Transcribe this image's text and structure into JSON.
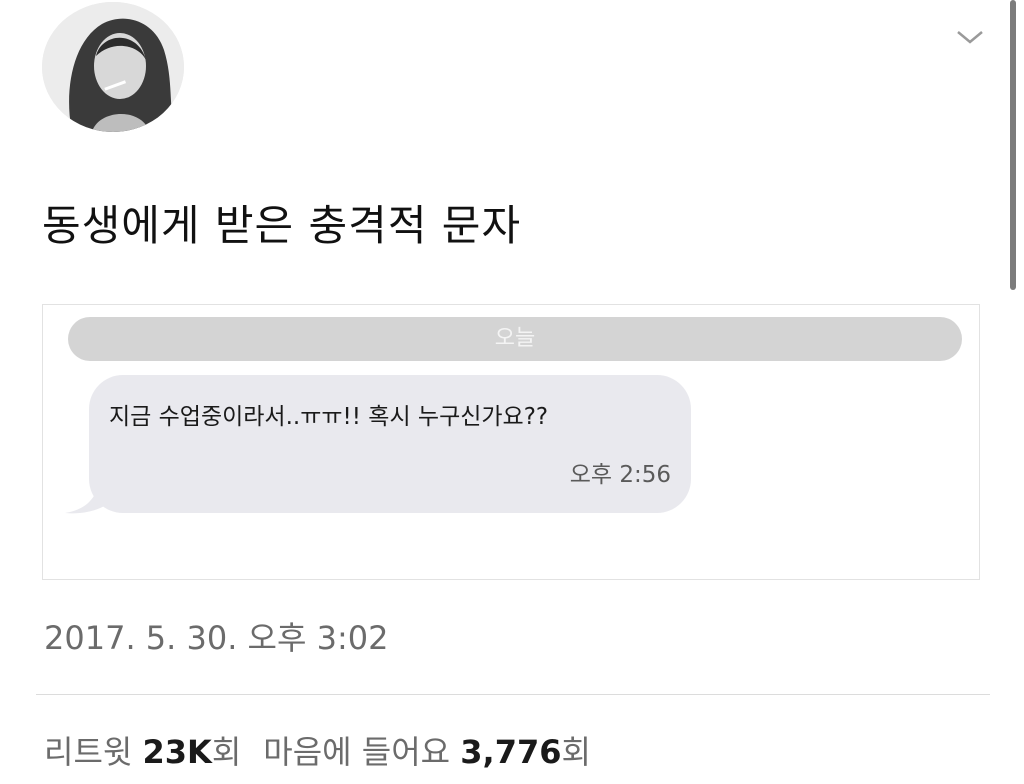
{
  "tweet": {
    "text": "동생에게 받은 충격적 문자",
    "timestamp": "2017. 5. 30. 오후 3:02",
    "avatar_icon": "profile-photo",
    "menu_icon": "chevron-down-icon"
  },
  "media": {
    "day_label": "오늘",
    "message": {
      "text": "지금 수업중이라서..ㅠㅠ!! 혹시 누구신가요??",
      "time": "오후 2:56"
    }
  },
  "stats": {
    "retweets_label": "리트윗",
    "retweets_count": "23K",
    "retweets_suffix": "회",
    "likes_label": "마음에 들어요",
    "likes_count": "3,776",
    "likes_suffix": "회"
  },
  "colors": {
    "bubble": "#e9e9ee",
    "day_pill": "#d4d4d4",
    "muted_text": "#6b6b6b"
  }
}
